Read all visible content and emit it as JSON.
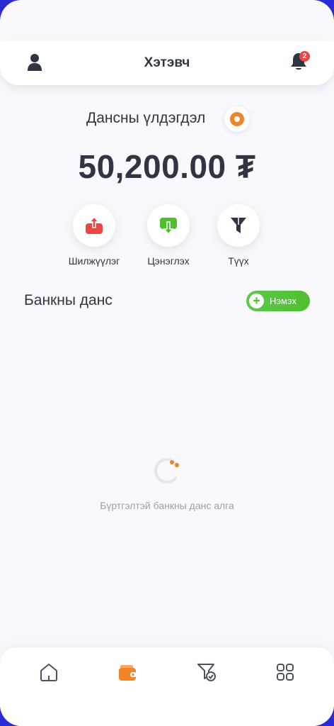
{
  "header": {
    "title": "Хэтэвч",
    "notification_count": "2",
    "icons": [
      "user-icon",
      "bell-icon"
    ]
  },
  "balance": {
    "label": "Дансны үлдэгдэл",
    "amount": "50,200.00 ₮",
    "visibility_icon": "eye-icon"
  },
  "actions": [
    {
      "label": "Шилжүүлэг",
      "icon": "upload-icon",
      "color": "#f04444"
    },
    {
      "label": "Цэнэглэх",
      "icon": "download-icon",
      "color": "#4fbf2f"
    },
    {
      "label": "Түүх",
      "icon": "filter-icon",
      "color": "#2f3542"
    }
  ],
  "bank_section": {
    "title": "Банкны данс",
    "add_label": "Нэмэх",
    "empty_text": "Бүртгэлтэй банкны данс алга"
  },
  "bottom_nav": {
    "items": [
      "home-icon",
      "wallet-icon",
      "history-icon",
      "grid-icon"
    ],
    "active_index": 1,
    "active_color": "#f08427"
  },
  "colors": {
    "accent": "#f08427",
    "success": "#4fbf2f",
    "danger": "#f04444",
    "text": "#2f3542"
  }
}
